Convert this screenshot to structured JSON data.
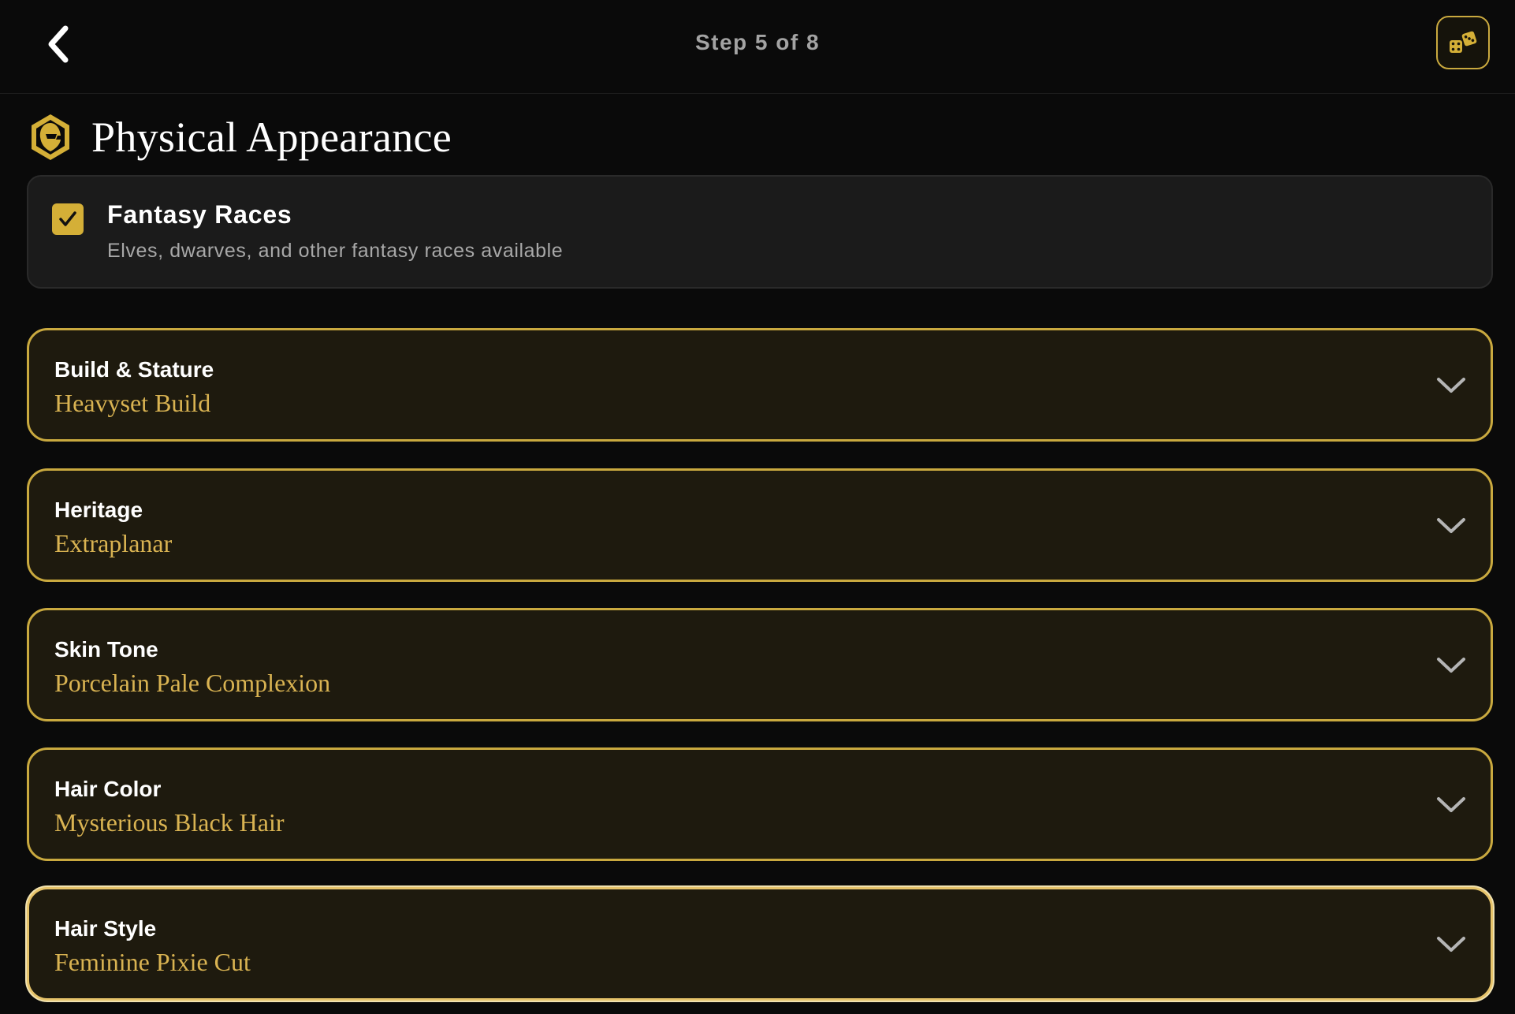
{
  "header": {
    "step_label": "Step 5 of 8",
    "back_icon": "chevron-left-icon",
    "random_icon": "dice-icon"
  },
  "section": {
    "title": "Physical Appearance",
    "icon": "hooded-figure-hexagon-icon"
  },
  "fantasy_toggle": {
    "title": "Fantasy Races",
    "description": "Elves, dwarves, and other fantasy races available",
    "checked": true,
    "check_glyph": "✓"
  },
  "fields": [
    {
      "label": "Build & Stature",
      "value": "Heavyset Build"
    },
    {
      "label": "Heritage",
      "value": "Extraplanar"
    },
    {
      "label": "Skin Tone",
      "value": "Porcelain Pale Complexion"
    },
    {
      "label": "Hair Color",
      "value": "Mysterious Black Hair"
    },
    {
      "label": "Hair Style",
      "value": "Feminine Pixie Cut"
    }
  ],
  "colors": {
    "background": "#0a0a0a",
    "accent_gold": "#c9a93f",
    "value_gold": "#d9b352",
    "card_fill": "#1e1a0e",
    "muted_text": "#a3a3a3"
  }
}
